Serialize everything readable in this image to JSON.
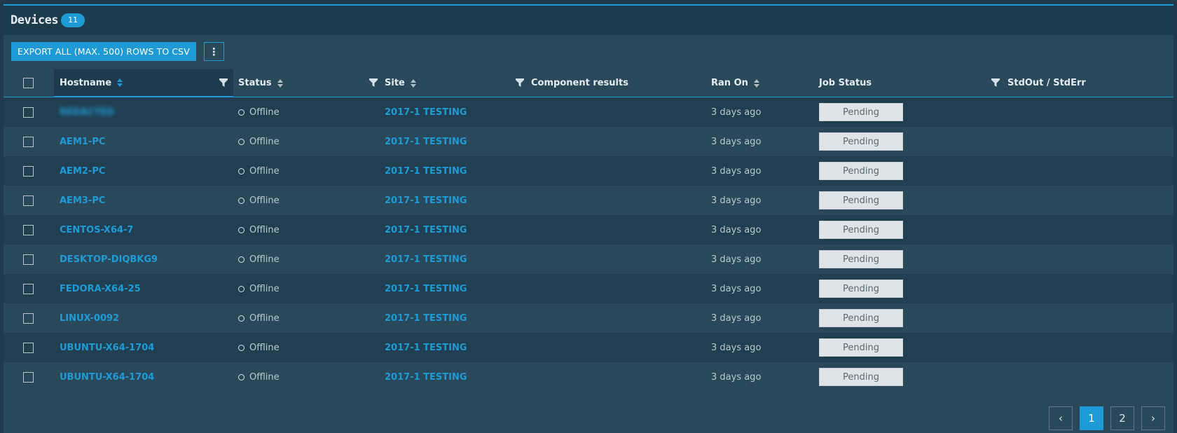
{
  "panel": {
    "title": "Devices",
    "count": "11"
  },
  "toolbar": {
    "export_label": "EXPORT ALL (MAX. 500) ROWS TO CSV",
    "more_label": "⋮"
  },
  "columns": {
    "hostname": "Hostname",
    "status": "Status",
    "site": "Site",
    "component_results": "Component results",
    "ran_on": "Ran On",
    "job_status": "Job Status",
    "stdout": "StdOut / StdErr"
  },
  "rows": [
    {
      "hostname": "REDACTED",
      "status": "Offline",
      "site": "2017-1 TESTING",
      "ran_on": "3 days ago",
      "job_status": "Pending"
    },
    {
      "hostname": "AEM1-PC",
      "status": "Offline",
      "site": "2017-1 TESTING",
      "ran_on": "3 days ago",
      "job_status": "Pending"
    },
    {
      "hostname": "AEM2-PC",
      "status": "Offline",
      "site": "2017-1 TESTING",
      "ran_on": "3 days ago",
      "job_status": "Pending"
    },
    {
      "hostname": "AEM3-PC",
      "status": "Offline",
      "site": "2017-1 TESTING",
      "ran_on": "3 days ago",
      "job_status": "Pending"
    },
    {
      "hostname": "CENTOS-X64-7",
      "status": "Offline",
      "site": "2017-1 TESTING",
      "ran_on": "3 days ago",
      "job_status": "Pending"
    },
    {
      "hostname": "DESKTOP-DIQBKG9",
      "status": "Offline",
      "site": "2017-1 TESTING",
      "ran_on": "3 days ago",
      "job_status": "Pending"
    },
    {
      "hostname": "FEDORA-X64-25",
      "status": "Offline",
      "site": "2017-1 TESTING",
      "ran_on": "3 days ago",
      "job_status": "Pending"
    },
    {
      "hostname": "LINUX-0092",
      "status": "Offline",
      "site": "2017-1 TESTING",
      "ran_on": "3 days ago",
      "job_status": "Pending"
    },
    {
      "hostname": "UBUNTU-X64-1704",
      "status": "Offline",
      "site": "2017-1 TESTING",
      "ran_on": "3 days ago",
      "job_status": "Pending"
    },
    {
      "hostname": "UBUNTU-X64-1704",
      "status": "Offline",
      "site": "2017-1 TESTING",
      "ran_on": "3 days ago",
      "job_status": "Pending"
    }
  ],
  "pagination": {
    "prev": "‹",
    "page1": "1",
    "page2": "2",
    "next": "›",
    "current": 1
  },
  "colors": {
    "accent": "#1e9bd7",
    "panel_bg": "#29495a",
    "row_alt": "#213f51",
    "pending_badge": "#dfe4e7"
  }
}
